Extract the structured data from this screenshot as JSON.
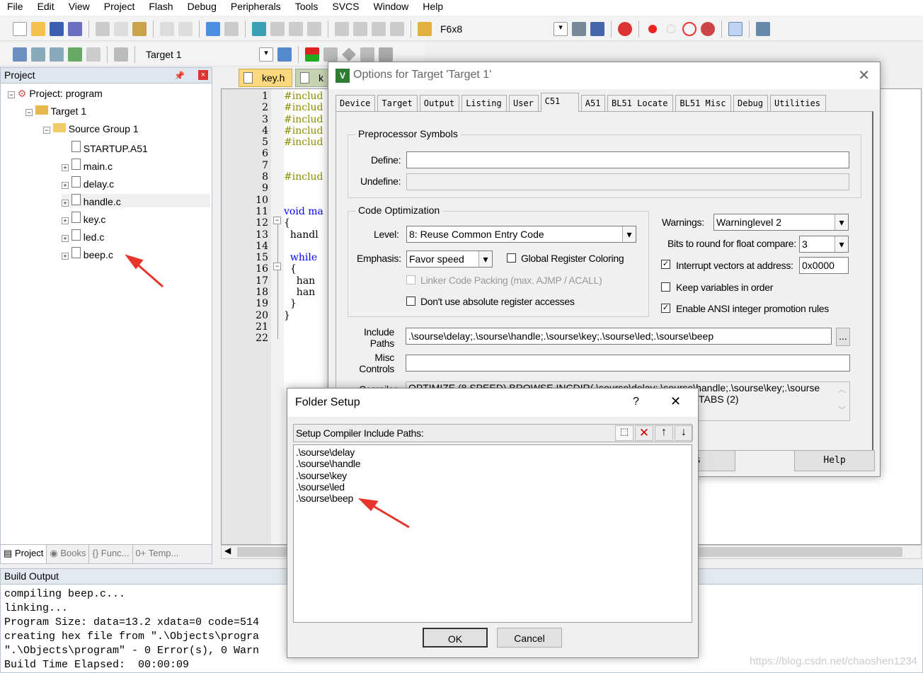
{
  "menu": [
    "File",
    "Edit",
    "View",
    "Project",
    "Flash",
    "Debug",
    "Peripherals",
    "Tools",
    "SVCS",
    "Window",
    "Help"
  ],
  "toolbar": {
    "find_value": "F6x8",
    "target_select": "Target 1"
  },
  "project_panel": {
    "title": "Project",
    "root": "Project: program",
    "target": "Target 1",
    "group": "Source Group 1",
    "files": [
      "STARTUP.A51",
      "main.c",
      "delay.c",
      "handle.c",
      "key.c",
      "led.c",
      "beep.c"
    ],
    "selected": "handle.c",
    "bottom_tabs": [
      "Project",
      "Books",
      "{} Func...",
      "0+ Temp..."
    ]
  },
  "editor": {
    "tabs": [
      "key.h",
      "k"
    ],
    "line_numbers": [
      "1",
      "2",
      "3",
      "4",
      "5",
      "6",
      "7",
      "8",
      "9",
      "10",
      "11",
      "12",
      "13",
      "14",
      "15",
      "16",
      "17",
      "18",
      "19",
      "20",
      "21",
      "22"
    ],
    "lines": [
      "#includ",
      "#includ",
      "#includ",
      "#includ",
      "#includ",
      "",
      "",
      "#includ",
      "",
      "",
      "void ma",
      "{",
      "  handl",
      "",
      "  while",
      "  {",
      "    han",
      "    han",
      "  }",
      "}",
      "",
      ""
    ]
  },
  "build_output": {
    "title": "Build Output",
    "lines": [
      "compiling beep.c...",
      "linking...",
      "Program Size: data=13.2 xdata=0 code=514",
      "creating hex file from \".\\Objects\\progra",
      "\".\\Objects\\program\" - 0 Error(s), 0 Warn",
      "Build Time Elapsed:  00:00:09"
    ]
  },
  "options_dialog": {
    "title": "Options for Target 'Target 1'",
    "tabs": [
      "Device",
      "Target",
      "Output",
      "Listing",
      "User",
      "C51",
      "A51",
      "BL51 Locate",
      "BL51 Misc",
      "Debug",
      "Utilities"
    ],
    "active_tab": "C51",
    "preprocessor": {
      "title": "Preprocessor Symbols",
      "define_label": "Define:",
      "define_value": "",
      "undefine_label": "Undefine:",
      "undefine_value": ""
    },
    "code_opt": {
      "title": "Code Optimization",
      "level_label": "Level:",
      "level_value": "8: Reuse Common Entry Code",
      "emphasis_label": "Emphasis:",
      "emphasis_value": "Favor speed",
      "global_reg": "Global Register Coloring",
      "linker_packing": "Linker Code Packing (max. AJMP / ACALL)",
      "no_abs": "Don't use absolute register accesses"
    },
    "warnings_label": "Warnings:",
    "warnings_value": "Warninglevel 2",
    "bits_label": "Bits to round for float compare:",
    "bits_value": "3",
    "interrupt_label": "Interrupt vectors at address:",
    "interrupt_value": "0x0000",
    "interrupt_checked": true,
    "keep_vars": "Keep variables in order",
    "keep_vars_checked": false,
    "ansi": "Enable ANSI integer promotion rules",
    "ansi_checked": true,
    "include_label": "Include\nPaths",
    "include_value": ".\\sourse\\delay;.\\sourse\\handle;.\\sourse\\key;.\\sourse\\led;.\\sourse\\beep",
    "browse": "...",
    "misc_label": "Misc\nControls",
    "misc_value": "",
    "compiler_label": "Compiler",
    "compiler_value_1": "OPTIMIZE (8,SPEED) BROWSE INCDIR(.\\sourse\\delay;.\\sourse\\handle;.\\sourse\\key;.\\sourse",
    "compiler_value_2": "TABS (2)",
    "defaults_button": "lts",
    "help_button": "Help"
  },
  "folder_dialog": {
    "title": "Folder Setup",
    "help": "?",
    "label": "Setup Compiler Include Paths:",
    "paths": [
      ".\\sourse\\delay",
      ".\\sourse\\handle",
      ".\\sourse\\key",
      ".\\sourse\\led",
      ".\\sourse\\beep"
    ],
    "ok": "OK",
    "cancel": "Cancel"
  },
  "watermark": "https://blog.csdn.net/chaoshen1234",
  "colors": {
    "accent_arrow": "#e8352b",
    "keyword": "#0000ff",
    "preprocessor": "#8b8b00",
    "panel_header": "#dfe6ee"
  }
}
